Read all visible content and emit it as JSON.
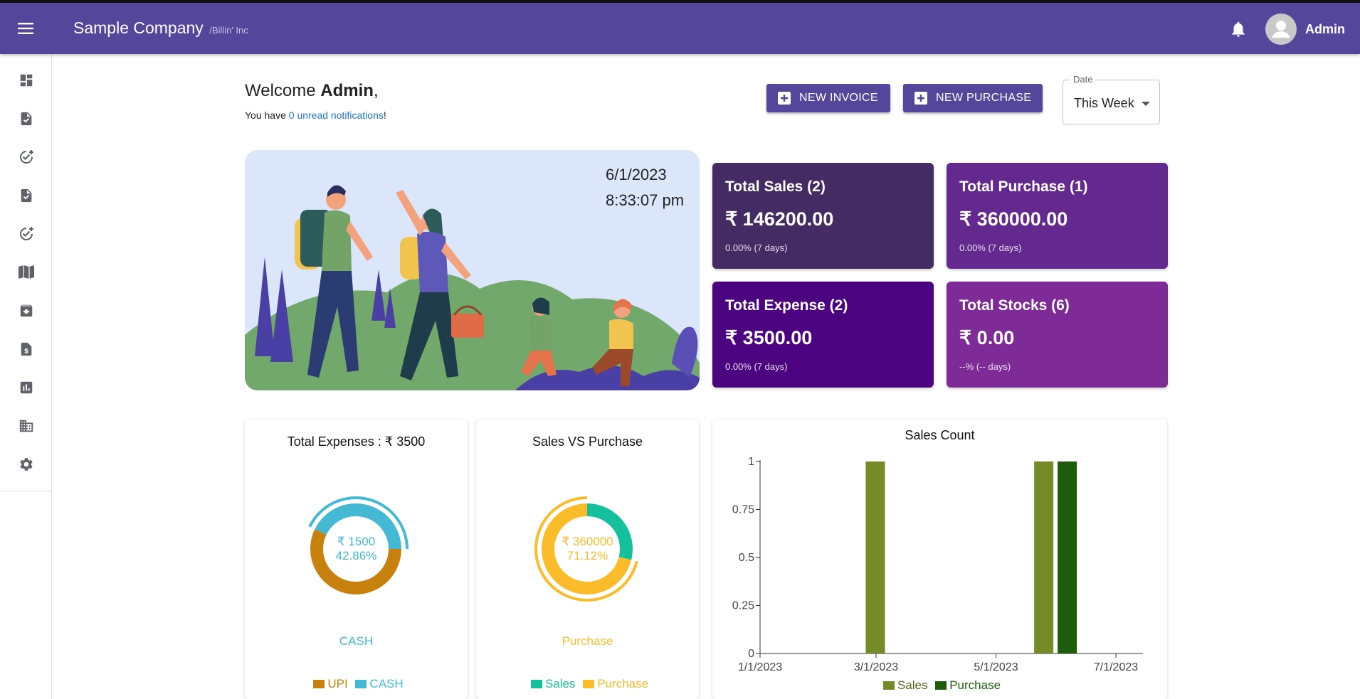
{
  "header": {
    "company": "Sample Company",
    "subtitle": "/Billin' Inc",
    "user": "Admin"
  },
  "icons": {
    "menu": "menu-icon",
    "bell": "bell-icon",
    "avatar": "user-avatar-icon",
    "sidebar": [
      "dashboard-icon",
      "invoice-icon",
      "add-check-icon",
      "purchase-icon",
      "add-check-icon",
      "book-icon",
      "archive-icon",
      "bill-icon",
      "report-icon",
      "business-icon",
      "settings-icon"
    ]
  },
  "welcome": {
    "prefix": "Welcome ",
    "name": "Admin",
    "suffix": ",",
    "notif_prefix": "You have ",
    "notif_link": "0 unread notifications",
    "notif_suffix": "!"
  },
  "actions": {
    "new_invoice": "NEW INVOICE",
    "new_purchase": "NEW PURCHASE"
  },
  "date_filter": {
    "label": "Date",
    "value": "This Week"
  },
  "hero": {
    "date": "6/1/2023",
    "time": "8:33:07 pm"
  },
  "stats": {
    "sales": {
      "title": "Total Sales (2)",
      "value": "₹ 146200.00",
      "change": "0.00% (7 days)"
    },
    "purchase": {
      "title": "Total Purchase (1)",
      "value": "₹ 360000.00",
      "change": "0.00% (7 days)"
    },
    "expense": {
      "title": "Total Expense (2)",
      "value": "₹ 3500.00",
      "change": "0.00% (7 days)"
    },
    "stocks": {
      "title": "Total Stocks (6)",
      "value": "₹ 0.00",
      "change": "--% (-- days)"
    }
  },
  "colors": {
    "appbar": "#53469b",
    "upi": "#c8800f",
    "cash": "#45b9d4",
    "sales": "#14c19c",
    "purchase": "#fbbc2b",
    "bar_sales": "#758b27",
    "bar_purchase": "#1c5c0a"
  },
  "expenses_chart": {
    "title": "Total Expenses : ₹ 3500",
    "center_value": "₹ 1500",
    "center_percent": "42.86%",
    "active_label": "CASH",
    "legend": [
      "UPI",
      "CASH"
    ]
  },
  "sales_purchase_chart": {
    "title": "Sales VS Purchase",
    "center_value": "₹ 360000",
    "center_percent": "71.12%",
    "active_label": "Purchase",
    "legend": [
      "Sales",
      "Purchase"
    ]
  },
  "sales_count_chart": {
    "title": "Sales Count",
    "legend": [
      "Sales",
      "Purchase"
    ]
  },
  "chart_data": [
    {
      "type": "pie",
      "title": "Total Expenses : ₹ 3500",
      "categories": [
        "UPI",
        "CASH"
      ],
      "values": [
        2000,
        1500
      ],
      "donut": true
    },
    {
      "type": "pie",
      "title": "Sales VS Purchase",
      "categories": [
        "Sales",
        "Purchase"
      ],
      "values": [
        146200,
        360000
      ],
      "donut": true
    },
    {
      "type": "bar",
      "title": "Sales Count",
      "x_ticks": [
        "1/1/2023",
        "3/1/2023",
        "5/1/2023",
        "7/1/2023"
      ],
      "y_ticks": [
        "0",
        "0.25",
        "0.5",
        "0.75",
        "1"
      ],
      "ylim": [
        0,
        1
      ],
      "series": [
        {
          "name": "Sales",
          "points": [
            {
              "x": "3/1/2023",
              "y": 1
            },
            {
              "x": "6/1/2023",
              "y": 1
            }
          ]
        },
        {
          "name": "Purchase",
          "points": [
            {
              "x": "6/1/2023",
              "y": 1
            }
          ]
        }
      ],
      "legend": "bottom"
    }
  ]
}
